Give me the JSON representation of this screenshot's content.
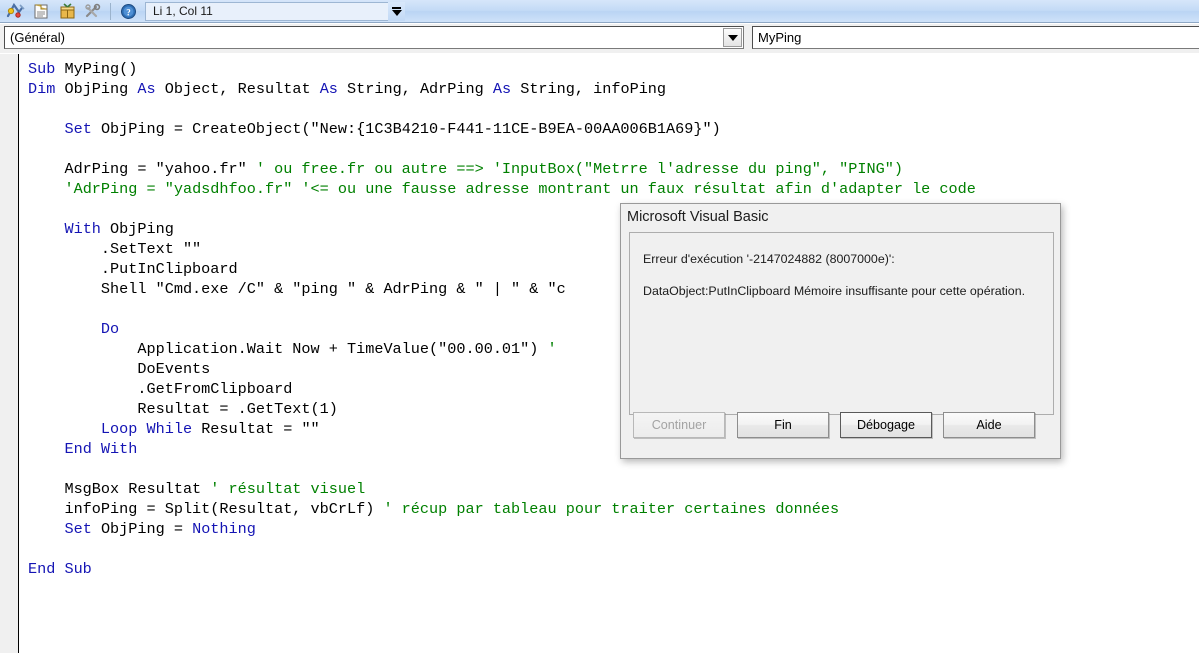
{
  "toolbar": {
    "position_field": "Li 1, Col 11",
    "icons": [
      {
        "name": "run-macro-icon",
        "glyph": "⚡"
      },
      {
        "name": "open-module-icon",
        "glyph": "▤"
      },
      {
        "name": "package-icon",
        "glyph": "▦"
      },
      {
        "name": "tools-icon",
        "glyph": "✂"
      },
      {
        "name": "help-icon",
        "glyph": "?"
      }
    ],
    "expand_chevron": "chevron-double-down"
  },
  "dropdowns": {
    "object_combo": {
      "value": "(Général)",
      "options": [
        "(Général)"
      ]
    },
    "procedure_combo": {
      "value": "MyPing",
      "options": [
        "MyPing"
      ]
    }
  },
  "code": {
    "lines": [
      [
        {
          "t": "Sub ",
          "c": "kw"
        },
        {
          "t": "MyPing()",
          "c": "pl"
        }
      ],
      [
        {
          "t": "Dim ",
          "c": "kw"
        },
        {
          "t": "ObjPing ",
          "c": "pl"
        },
        {
          "t": "As ",
          "c": "kw"
        },
        {
          "t": "Object",
          "c": "pl"
        },
        {
          "t": ", Resultat ",
          "c": "pl"
        },
        {
          "t": "As ",
          "c": "kw"
        },
        {
          "t": "String",
          "c": "pl"
        },
        {
          "t": ", AdrPing ",
          "c": "pl"
        },
        {
          "t": "As ",
          "c": "kw"
        },
        {
          "t": "String",
          "c": "pl"
        },
        {
          "t": ", infoPing",
          "c": "pl"
        }
      ],
      [],
      [
        {
          "t": "    ",
          "c": "pl"
        },
        {
          "t": "Set ",
          "c": "kw"
        },
        {
          "t": "ObjPing = CreateObject(\"New:{1C3B4210-F441-11CE-B9EA-00AA006B1A69}\")",
          "c": "pl"
        }
      ],
      [],
      [
        {
          "t": "    AdrPing = \"yahoo.fr\" ",
          "c": "pl"
        },
        {
          "t": "' ou free.fr ou autre ==> 'InputBox(\"Metrre l'adresse du ping\", \"PING\")",
          "c": "cm"
        }
      ],
      [
        {
          "t": "    ",
          "c": "pl"
        },
        {
          "t": "'AdrPing = \"yadsdhfoo.fr\" '<= ou une fausse adresse montrant un faux résultat afin d'adapter le code",
          "c": "cm"
        }
      ],
      [],
      [
        {
          "t": "    ",
          "c": "pl"
        },
        {
          "t": "With ",
          "c": "kw"
        },
        {
          "t": "ObjPing",
          "c": "pl"
        }
      ],
      [
        {
          "t": "        .SetText \"\"",
          "c": "pl"
        }
      ],
      [
        {
          "t": "        .PutInClipboard",
          "c": "pl"
        }
      ],
      [
        {
          "t": "        Shell \"Cmd.exe /C\" & \"ping \" & AdrPing & \" | \" & \"c",
          "c": "pl"
        }
      ],
      [],
      [
        {
          "t": "        ",
          "c": "pl"
        },
        {
          "t": "Do",
          "c": "kw"
        }
      ],
      [
        {
          "t": "            Application.Wait Now + TimeValue(\"00.00.01\") ",
          "c": "pl"
        },
        {
          "t": "'",
          "c": "cm"
        }
      ],
      [
        {
          "t": "            DoEvents",
          "c": "pl"
        }
      ],
      [
        {
          "t": "            .GetFromClipboard",
          "c": "pl"
        }
      ],
      [
        {
          "t": "            Resultat = .GetText(1)",
          "c": "pl"
        }
      ],
      [
        {
          "t": "        ",
          "c": "pl"
        },
        {
          "t": "Loop While ",
          "c": "kw"
        },
        {
          "t": "Resultat = \"\"",
          "c": "pl"
        }
      ],
      [
        {
          "t": "    ",
          "c": "pl"
        },
        {
          "t": "End With",
          "c": "kw"
        }
      ],
      [],
      [
        {
          "t": "    MsgBox Resultat ",
          "c": "pl"
        },
        {
          "t": "' résultat visuel",
          "c": "cm"
        }
      ],
      [
        {
          "t": "    infoPing = Split(Resultat, vbCrLf) ",
          "c": "pl"
        },
        {
          "t": "' récup par tableau pour traiter certaines données",
          "c": "cm"
        }
      ],
      [
        {
          "t": "    ",
          "c": "pl"
        },
        {
          "t": "Set ",
          "c": "kw"
        },
        {
          "t": "ObjPing = ",
          "c": "pl"
        },
        {
          "t": "Nothing",
          "c": "kw"
        }
      ],
      [],
      [
        {
          "t": "End Sub",
          "c": "kw"
        }
      ]
    ]
  },
  "dialog": {
    "title": "Microsoft Visual Basic",
    "message_line1": "Erreur d'exécution '-2147024882 (8007000e)':",
    "message_line2": "DataObject:PutInClipboard Mémoire insuffisante pour cette opération.",
    "buttons": [
      {
        "id": "continuer",
        "label": "Continuer",
        "disabled": true
      },
      {
        "id": "fin",
        "label": "Fin",
        "disabled": false
      },
      {
        "id": "debogage",
        "label": "Débogage",
        "disabled": false
      },
      {
        "id": "aide",
        "label": "Aide",
        "disabled": false
      }
    ]
  },
  "colors": {
    "keyword": "#1414b4",
    "comment": "#008000",
    "toolbar_bg": "#c3daf6",
    "dialog_bg": "#f0f0f0"
  }
}
